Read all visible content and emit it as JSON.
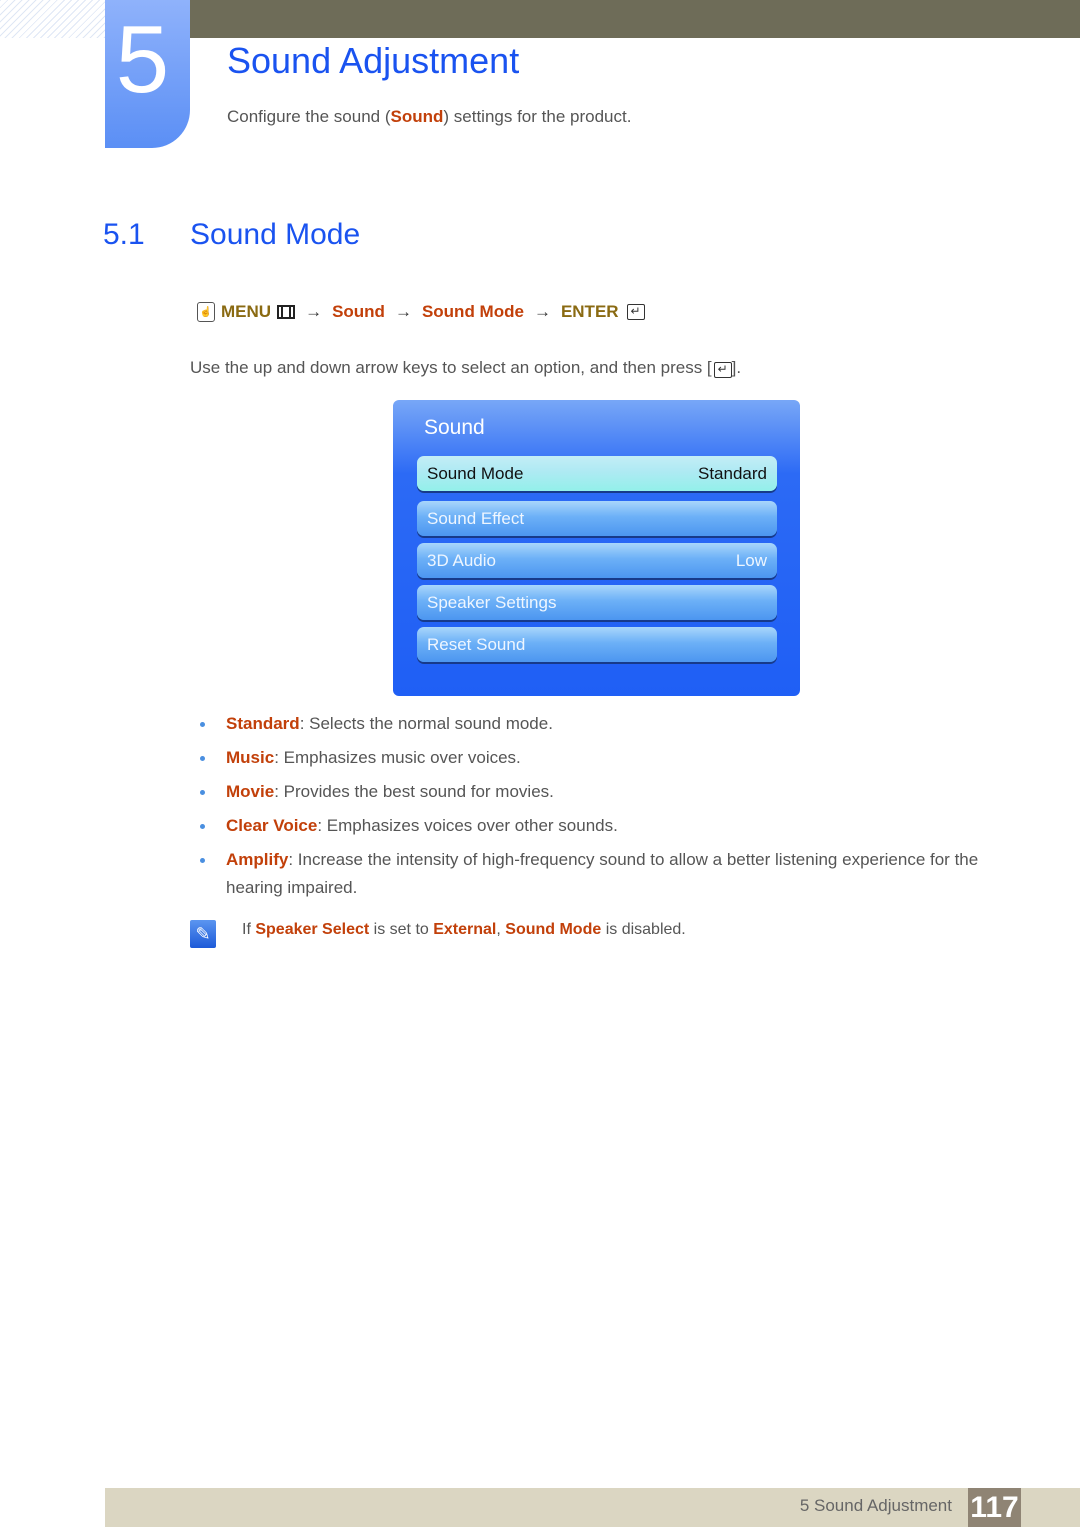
{
  "chapter": {
    "number": "5",
    "title": "Sound Adjustment",
    "intro_before": "Configure the sound (",
    "intro_highlight": "Sound",
    "intro_after": ") settings for the product."
  },
  "section": {
    "number": "5.1",
    "title": "Sound Mode"
  },
  "menu_path": {
    "hand_icon": "remote-hand-icon",
    "menu_label": "MENU",
    "menu_icon": "menu-icon",
    "arrow": "→",
    "steps": [
      "Sound",
      "Sound Mode"
    ],
    "enter_label": "ENTER",
    "enter_icon": "enter-icon"
  },
  "instruction": {
    "text": "Use the up and down arrow keys to select an option, and then press [",
    "suffix": "]."
  },
  "tv_menu": {
    "title": "Sound",
    "items": [
      {
        "label": "Sound Mode",
        "value": "Standard",
        "selected": true
      },
      {
        "label": "Sound Effect",
        "value": ""
      },
      {
        "label": "3D Audio",
        "value": "Low"
      },
      {
        "label": "Speaker Settings",
        "value": ""
      },
      {
        "label": "Reset Sound",
        "value": ""
      }
    ]
  },
  "options": [
    {
      "term": "Standard",
      "desc": ": Selects the normal sound mode."
    },
    {
      "term": "Music",
      "desc": ": Emphasizes music over voices."
    },
    {
      "term": "Movie",
      "desc": ": Provides the best sound for movies."
    },
    {
      "term": "Clear Voice",
      "desc": ": Emphasizes voices over other sounds."
    },
    {
      "term": "Amplify",
      "desc": ": Increase the intensity of high-frequency sound to allow a better listening experience for the hearing impaired."
    }
  ],
  "note": {
    "icon": "note-pencil-icon",
    "p1": "If ",
    "h1": "Speaker Select",
    "p2": " is set to ",
    "h2": "External",
    "p3": ", ",
    "h3": "Sound Mode",
    "p4": " is disabled."
  },
  "footer": {
    "label": "5 Sound Adjustment",
    "page": "117"
  },
  "colors": {
    "heading_blue": "#1a53f0",
    "highlight_orange": "#c2400a",
    "menu_gold": "#8a6a12",
    "top_bar": "#6e6c58",
    "footer_bg": "#dbd6c2",
    "page_badge": "#8f8474"
  }
}
